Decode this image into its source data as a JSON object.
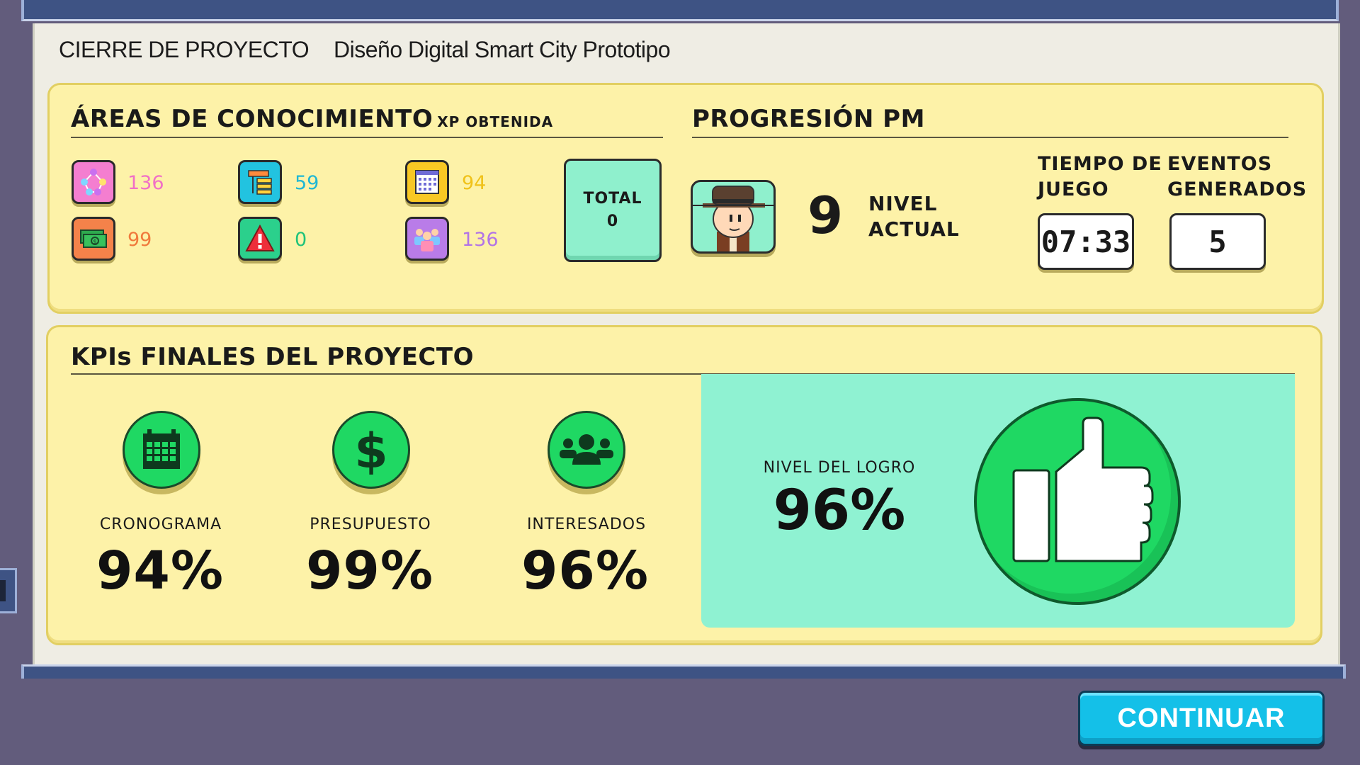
{
  "header": {
    "label": "CIERRE DE PROYECTO",
    "project_name": "Diseño Digital Smart City Prototipo"
  },
  "knowledge_areas": {
    "title": "ÁREAS DE CONOCIMIENTO",
    "subtitle": "XP OBTENIDA",
    "items": [
      {
        "icon": "integration-network-icon",
        "value": "136",
        "color": "#f170c6"
      },
      {
        "icon": "scope-wbs-icon",
        "value": "59",
        "color": "#1fb7d4"
      },
      {
        "icon": "schedule-calendar-icon",
        "value": "94",
        "color": "#f0c21a"
      },
      {
        "icon": "cost-money-icon",
        "value": "99",
        "color": "#f07a3c"
      },
      {
        "icon": "risk-warning-icon",
        "value": "0",
        "color": "#20c37a"
      },
      {
        "icon": "stakeholders-people-icon",
        "value": "136",
        "color": "#b274e6"
      }
    ],
    "total_label": "TOTAL",
    "total_value": "0"
  },
  "progression": {
    "title": "PROGRESIÓN PM",
    "avatar_icon": "explorer-avatar-icon",
    "level_value": "9",
    "level_label_line1": "NIVEL",
    "level_label_line2": "ACTUAL",
    "time_label_line1": "TIEMPO DE",
    "time_label_line2": "JUEGO",
    "time_value": "07:33",
    "events_label_line1": "EVENTOS",
    "events_label_line2": "GENERADOS",
    "events_value": "5"
  },
  "kpis": {
    "title": "KPIs FINALES DEL PROYECTO",
    "items": [
      {
        "icon": "calendar-icon",
        "label": "CRONOGRAMA",
        "value": "94%"
      },
      {
        "icon": "dollar-icon",
        "label": "PRESUPUESTO",
        "value": "99%"
      },
      {
        "icon": "people-icon",
        "label": "INTERESADOS",
        "value": "96%"
      }
    ],
    "achievement_label": "NIVEL DEL LOGRO",
    "achievement_value": "96%",
    "achievement_icon": "thumbs-up-icon"
  },
  "buttons": {
    "continue_label": "CONTINUAR"
  },
  "colors": {
    "panel_bg": "#fdf2a8",
    "mint": "#8ff2d2",
    "kpi_green": "#1fd863",
    "button_cyan": "#14c0e8"
  }
}
